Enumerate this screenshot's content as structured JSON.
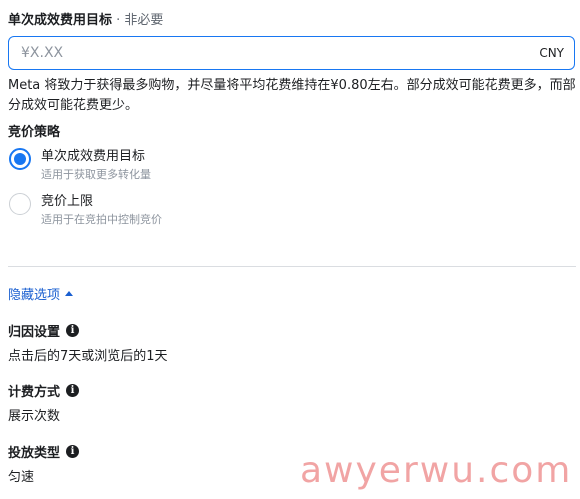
{
  "header": {
    "title": "单次成效费用目标",
    "separator": " · ",
    "optional": "非必要"
  },
  "cost_input": {
    "placeholder": "¥X.XX",
    "value": "",
    "currency": "CNY"
  },
  "help_text": "Meta 将致力于获得最多购物，并尽量将平均花费维持在¥0.80左右。部分成效可能花费更多，而部分成效可能花费更少。",
  "bid_strategy": {
    "label": "竞价策略",
    "options": [
      {
        "title": "单次成效费用目标",
        "description": "适用于获取更多转化量",
        "selected": true
      },
      {
        "title": "竞价上限",
        "description": "适用于在竞拍中控制竞价",
        "selected": false
      }
    ]
  },
  "toggle": {
    "label": "隐藏选项"
  },
  "fields": [
    {
      "label": "归因设置",
      "value": "点击后的7天或浏览后的1天"
    },
    {
      "label": "计费方式",
      "value": "展示次数"
    },
    {
      "label": "投放类型",
      "value": "匀速"
    }
  ],
  "icons": {
    "info": "info-icon",
    "caret": "caret-up-icon"
  },
  "colors": {
    "accent": "#1877f2",
    "link": "#1a5fd0"
  },
  "watermark": "awyerwu.com"
}
